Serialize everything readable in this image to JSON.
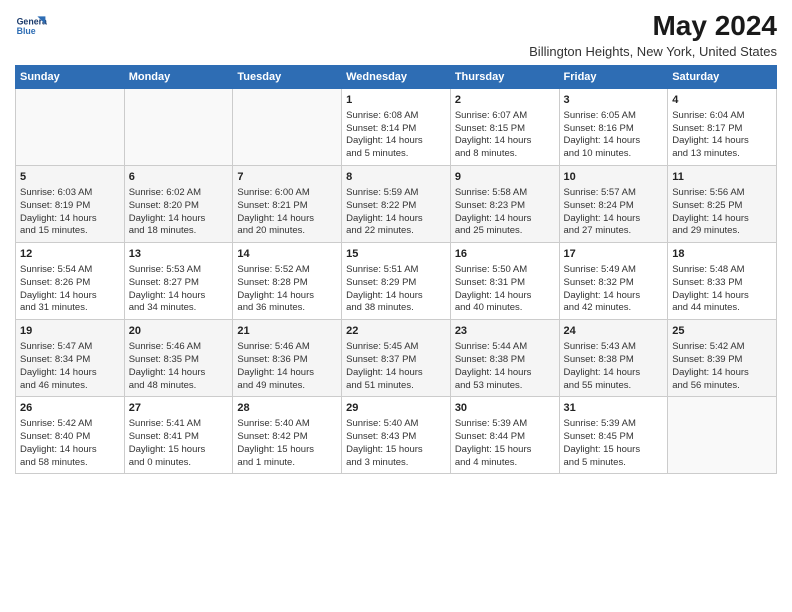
{
  "header": {
    "logo_line1": "General",
    "logo_line2": "Blue",
    "title": "May 2024",
    "subtitle": "Billington Heights, New York, United States"
  },
  "weekdays": [
    "Sunday",
    "Monday",
    "Tuesday",
    "Wednesday",
    "Thursday",
    "Friday",
    "Saturday"
  ],
  "weeks": [
    [
      {
        "day": "",
        "info": ""
      },
      {
        "day": "",
        "info": ""
      },
      {
        "day": "",
        "info": ""
      },
      {
        "day": "1",
        "info": "Sunrise: 6:08 AM\nSunset: 8:14 PM\nDaylight: 14 hours\nand 5 minutes."
      },
      {
        "day": "2",
        "info": "Sunrise: 6:07 AM\nSunset: 8:15 PM\nDaylight: 14 hours\nand 8 minutes."
      },
      {
        "day": "3",
        "info": "Sunrise: 6:05 AM\nSunset: 8:16 PM\nDaylight: 14 hours\nand 10 minutes."
      },
      {
        "day": "4",
        "info": "Sunrise: 6:04 AM\nSunset: 8:17 PM\nDaylight: 14 hours\nand 13 minutes."
      }
    ],
    [
      {
        "day": "5",
        "info": "Sunrise: 6:03 AM\nSunset: 8:19 PM\nDaylight: 14 hours\nand 15 minutes."
      },
      {
        "day": "6",
        "info": "Sunrise: 6:02 AM\nSunset: 8:20 PM\nDaylight: 14 hours\nand 18 minutes."
      },
      {
        "day": "7",
        "info": "Sunrise: 6:00 AM\nSunset: 8:21 PM\nDaylight: 14 hours\nand 20 minutes."
      },
      {
        "day": "8",
        "info": "Sunrise: 5:59 AM\nSunset: 8:22 PM\nDaylight: 14 hours\nand 22 minutes."
      },
      {
        "day": "9",
        "info": "Sunrise: 5:58 AM\nSunset: 8:23 PM\nDaylight: 14 hours\nand 25 minutes."
      },
      {
        "day": "10",
        "info": "Sunrise: 5:57 AM\nSunset: 8:24 PM\nDaylight: 14 hours\nand 27 minutes."
      },
      {
        "day": "11",
        "info": "Sunrise: 5:56 AM\nSunset: 8:25 PM\nDaylight: 14 hours\nand 29 minutes."
      }
    ],
    [
      {
        "day": "12",
        "info": "Sunrise: 5:54 AM\nSunset: 8:26 PM\nDaylight: 14 hours\nand 31 minutes."
      },
      {
        "day": "13",
        "info": "Sunrise: 5:53 AM\nSunset: 8:27 PM\nDaylight: 14 hours\nand 34 minutes."
      },
      {
        "day": "14",
        "info": "Sunrise: 5:52 AM\nSunset: 8:28 PM\nDaylight: 14 hours\nand 36 minutes."
      },
      {
        "day": "15",
        "info": "Sunrise: 5:51 AM\nSunset: 8:29 PM\nDaylight: 14 hours\nand 38 minutes."
      },
      {
        "day": "16",
        "info": "Sunrise: 5:50 AM\nSunset: 8:31 PM\nDaylight: 14 hours\nand 40 minutes."
      },
      {
        "day": "17",
        "info": "Sunrise: 5:49 AM\nSunset: 8:32 PM\nDaylight: 14 hours\nand 42 minutes."
      },
      {
        "day": "18",
        "info": "Sunrise: 5:48 AM\nSunset: 8:33 PM\nDaylight: 14 hours\nand 44 minutes."
      }
    ],
    [
      {
        "day": "19",
        "info": "Sunrise: 5:47 AM\nSunset: 8:34 PM\nDaylight: 14 hours\nand 46 minutes."
      },
      {
        "day": "20",
        "info": "Sunrise: 5:46 AM\nSunset: 8:35 PM\nDaylight: 14 hours\nand 48 minutes."
      },
      {
        "day": "21",
        "info": "Sunrise: 5:46 AM\nSunset: 8:36 PM\nDaylight: 14 hours\nand 49 minutes."
      },
      {
        "day": "22",
        "info": "Sunrise: 5:45 AM\nSunset: 8:37 PM\nDaylight: 14 hours\nand 51 minutes."
      },
      {
        "day": "23",
        "info": "Sunrise: 5:44 AM\nSunset: 8:38 PM\nDaylight: 14 hours\nand 53 minutes."
      },
      {
        "day": "24",
        "info": "Sunrise: 5:43 AM\nSunset: 8:38 PM\nDaylight: 14 hours\nand 55 minutes."
      },
      {
        "day": "25",
        "info": "Sunrise: 5:42 AM\nSunset: 8:39 PM\nDaylight: 14 hours\nand 56 minutes."
      }
    ],
    [
      {
        "day": "26",
        "info": "Sunrise: 5:42 AM\nSunset: 8:40 PM\nDaylight: 14 hours\nand 58 minutes."
      },
      {
        "day": "27",
        "info": "Sunrise: 5:41 AM\nSunset: 8:41 PM\nDaylight: 15 hours\nand 0 minutes."
      },
      {
        "day": "28",
        "info": "Sunrise: 5:40 AM\nSunset: 8:42 PM\nDaylight: 15 hours\nand 1 minute."
      },
      {
        "day": "29",
        "info": "Sunrise: 5:40 AM\nSunset: 8:43 PM\nDaylight: 15 hours\nand 3 minutes."
      },
      {
        "day": "30",
        "info": "Sunrise: 5:39 AM\nSunset: 8:44 PM\nDaylight: 15 hours\nand 4 minutes."
      },
      {
        "day": "31",
        "info": "Sunrise: 5:39 AM\nSunset: 8:45 PM\nDaylight: 15 hours\nand 5 minutes."
      },
      {
        "day": "",
        "info": ""
      }
    ]
  ]
}
